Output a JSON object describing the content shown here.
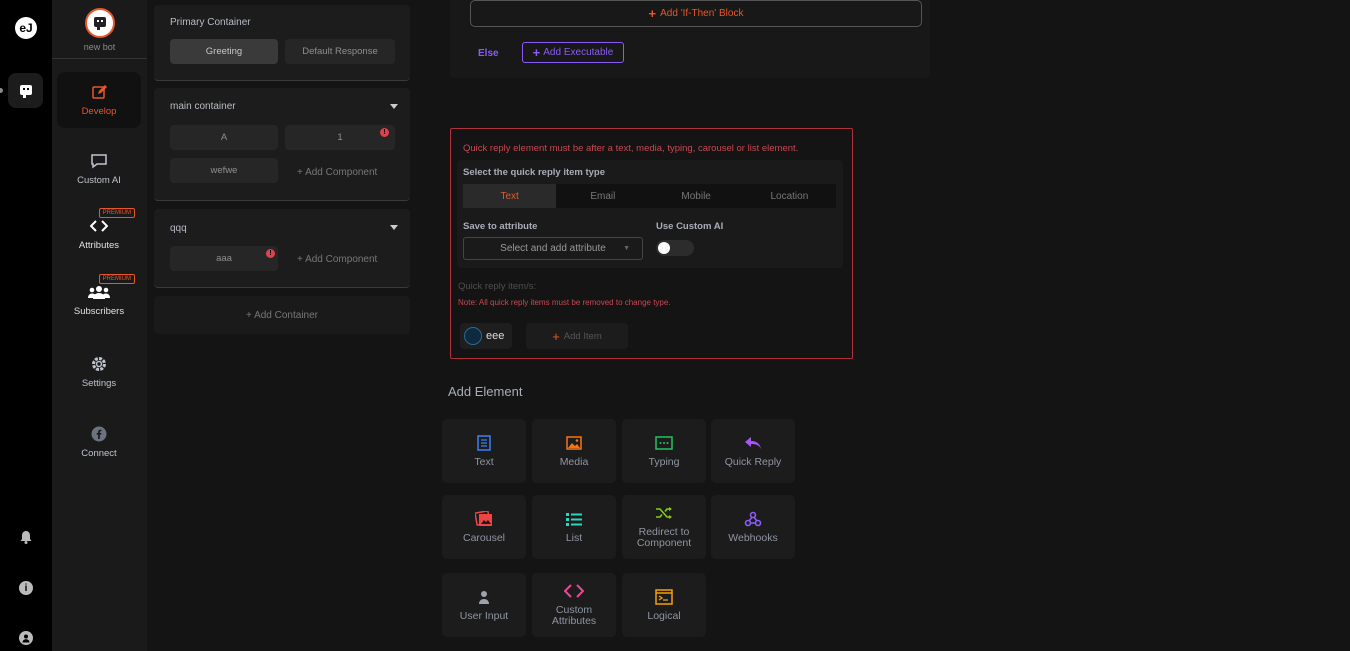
{
  "rail": {
    "logo_text": "eJ",
    "icons": [
      "logo-icon",
      "bot-icon",
      "bell-icon",
      "info-icon",
      "user-icon"
    ]
  },
  "sidebar": {
    "bot_name": "new bot",
    "premium_label": "PREMIUM",
    "items": [
      {
        "label": "Develop",
        "icon": "edit-icon",
        "active": true
      },
      {
        "label": "Custom AI",
        "icon": "chat-icon",
        "active": false
      },
      {
        "label": "Attributes",
        "icon": "code-icon",
        "premium": true
      },
      {
        "label": "Subscribers",
        "icon": "users-icon",
        "premium": true
      },
      {
        "label": "Settings",
        "icon": "gear-icon"
      },
      {
        "label": "Connect",
        "icon": "facebook-icon"
      }
    ]
  },
  "containers": {
    "primary": {
      "title": "Primary Container",
      "chips": [
        "Greeting",
        "Default Response"
      ]
    },
    "main": {
      "title": "main container",
      "chips": [
        "A",
        "1",
        "wefwe"
      ],
      "add_component": "+ Add Component"
    },
    "qqq": {
      "title": "qqq",
      "chips": [
        "aaa"
      ],
      "add_component": "+ Add Component"
    },
    "add_container": "+ Add Container"
  },
  "logic_block": {
    "add_if_then": "Add 'If-Then' Block",
    "else_label": "Else",
    "add_executable": "Add Executable"
  },
  "quick_reply": {
    "warning": "Quick reply element must be after a text, media, typing, carousel or list element.",
    "type_label": "Select the quick reply item type",
    "types": [
      "Text",
      "Email",
      "Mobile",
      "Location"
    ],
    "selected_type": "Text",
    "save_label": "Save to attribute",
    "select_placeholder": "Select and add attribute",
    "custom_ai_label": "Use Custom AI",
    "custom_ai_enabled": false,
    "items_label": "Quick reply item/s:",
    "note": "Note: All quick reply items must be removed to change type.",
    "items": [
      "eee"
    ],
    "add_item": "Add Item"
  },
  "add_element": {
    "title": "Add Element",
    "tiles": [
      {
        "label": "Text",
        "icon": "document-icon",
        "color": "#3b82f6"
      },
      {
        "label": "Media",
        "icon": "image-icon",
        "color": "#f97316"
      },
      {
        "label": "Typing",
        "icon": "typing-icon",
        "color": "#22c55e"
      },
      {
        "label": "Quick Reply",
        "icon": "reply-icon",
        "color": "#a855f7"
      },
      {
        "label": "Carousel",
        "icon": "carousel-icon",
        "color": "#ef4444"
      },
      {
        "label": "List",
        "icon": "list-icon",
        "color": "#2dd4bf"
      },
      {
        "label": "Redirect to Component",
        "icon": "shuffle-icon",
        "color": "#84cc16"
      },
      {
        "label": "Webhooks",
        "icon": "webhook-icon",
        "color": "#8b5cf6"
      },
      {
        "label": "User Input",
        "icon": "person-icon",
        "color": "#9ca3af"
      },
      {
        "label": "Custom Attributes",
        "icon": "code-icon",
        "color": "#ec4899"
      },
      {
        "label": "Logical",
        "icon": "terminal-icon",
        "color": "#f59e0b"
      }
    ]
  },
  "colors": {
    "accent": "#e8572a",
    "purple": "#8a5cf5",
    "error": "#c84752"
  }
}
